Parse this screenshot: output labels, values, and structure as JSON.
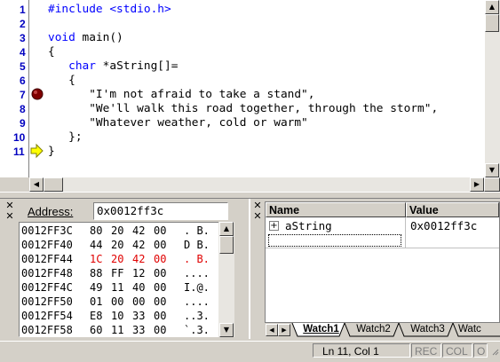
{
  "editor": {
    "line_numbers": [
      "1",
      "2",
      "3",
      "4",
      "5",
      "6",
      "7",
      "8",
      "9",
      "10",
      "11"
    ],
    "lines": [
      {
        "parts": [
          {
            "t": "#include <stdio.h>",
            "c": "kw"
          }
        ]
      },
      {
        "parts": [
          {
            "t": "",
            "c": ""
          }
        ]
      },
      {
        "parts": [
          {
            "t": "void ",
            "c": "kw"
          },
          {
            "t": "main()",
            "c": ""
          }
        ]
      },
      {
        "parts": [
          {
            "t": "{",
            "c": ""
          }
        ]
      },
      {
        "parts": [
          {
            "t": "   ",
            "c": ""
          },
          {
            "t": "char",
            "c": "kw"
          },
          {
            "t": " *aString[]=",
            "c": ""
          }
        ]
      },
      {
        "parts": [
          {
            "t": "   {",
            "c": ""
          }
        ]
      },
      {
        "parts": [
          {
            "t": "      \"I'm not afraid to take a stand\",",
            "c": ""
          }
        ]
      },
      {
        "parts": [
          {
            "t": "      \"We'll walk this road together, through the storm\",",
            "c": ""
          }
        ]
      },
      {
        "parts": [
          {
            "t": "      \"Whatever weather, cold or warm\"",
            "c": ""
          }
        ]
      },
      {
        "parts": [
          {
            "t": "   };",
            "c": ""
          }
        ]
      },
      {
        "parts": [
          {
            "t": "}",
            "c": ""
          }
        ]
      }
    ],
    "breakpoint_line": "7",
    "current_line": "11"
  },
  "memory": {
    "address_label": "Address:",
    "address_value": "0x0012ff3c",
    "rows": [
      {
        "addr": "0012FF3C",
        "bytes": [
          "80",
          "20",
          "42",
          "00"
        ],
        "ascii": ". B.",
        "highlight": false
      },
      {
        "addr": "0012FF40",
        "bytes": [
          "44",
          "20",
          "42",
          "00"
        ],
        "ascii": "D B.",
        "highlight": false
      },
      {
        "addr": "0012FF44",
        "bytes": [
          "1C",
          "20",
          "42",
          "00"
        ],
        "ascii": ". B.",
        "highlight": true
      },
      {
        "addr": "0012FF48",
        "bytes": [
          "88",
          "FF",
          "12",
          "00"
        ],
        "ascii": "....",
        "highlight": false
      },
      {
        "addr": "0012FF4C",
        "bytes": [
          "49",
          "11",
          "40",
          "00"
        ],
        "ascii": "I.@.",
        "highlight": false
      },
      {
        "addr": "0012FF50",
        "bytes": [
          "01",
          "00",
          "00",
          "00"
        ],
        "ascii": "....",
        "highlight": false
      },
      {
        "addr": "0012FF54",
        "bytes": [
          "E8",
          "10",
          "33",
          "00"
        ],
        "ascii": "..3.",
        "highlight": false
      },
      {
        "addr": "0012FF58",
        "bytes": [
          "60",
          "11",
          "33",
          "00"
        ],
        "ascii": "`.3.",
        "highlight": false
      }
    ]
  },
  "watch": {
    "col_name": "Name",
    "col_value": "Value",
    "rows": [
      {
        "expander": "+",
        "name": "aString",
        "value": "0x0012ff3c"
      }
    ],
    "tabs": [
      "Watch1",
      "Watch2",
      "Watch3",
      "Watc"
    ],
    "active_tab": "Watch1"
  },
  "status": {
    "position": "Ln 11, Col 1",
    "rec": "REC",
    "col": "COL",
    "ovr": "O"
  },
  "colors": {
    "keyword": "#0000ff",
    "line_number": "#0000c0",
    "changed_memory": "#e00000",
    "breakpoint": "#800000",
    "current_arrow": "#ffff00"
  }
}
